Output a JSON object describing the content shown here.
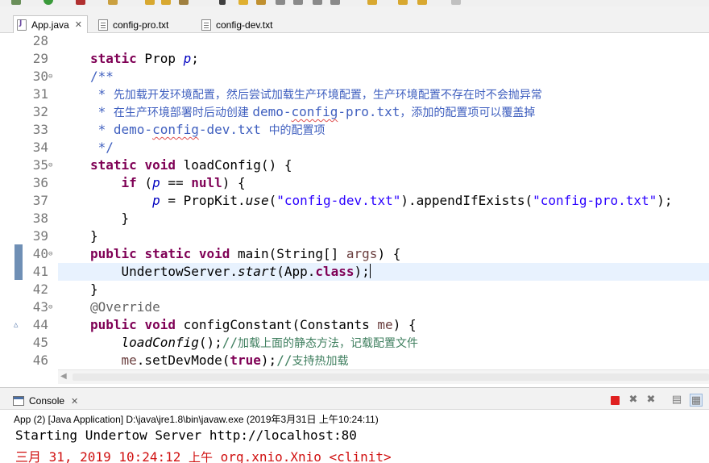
{
  "editor_tabs": [
    {
      "label": "App.java",
      "active": true,
      "icon": "java-file-icon",
      "closable": true
    },
    {
      "label": "config-pro.txt",
      "active": false,
      "icon": "text-file-icon"
    },
    {
      "label": "config-dev.txt",
      "active": false,
      "icon": "text-file-icon"
    }
  ],
  "code_lines": [
    {
      "num": "28",
      "parts": []
    },
    {
      "num": "29",
      "parts": [
        [
          "kw",
          "static"
        ],
        [
          "id",
          " Prop "
        ],
        [
          "field",
          "p"
        ],
        [
          "id",
          ";"
        ]
      ]
    },
    {
      "num": "30",
      "fold": "collapse",
      "parts": [
        [
          "cm",
          "/**"
        ]
      ]
    },
    {
      "num": "31",
      "parts": [
        [
          "cm",
          " * "
        ],
        [
          "cm-cn",
          "先加载开发环境配置，然后尝试加载生产环境配置，生产环境配置不存在时不会抛异常"
        ]
      ]
    },
    {
      "num": "32",
      "parts": [
        [
          "cm",
          " * "
        ],
        [
          "cm-cn",
          "在生产环境部署时后动创建 "
        ],
        [
          "cm",
          "demo-"
        ],
        [
          "cm squig",
          "config"
        ],
        [
          "cm",
          "-pro.txt"
        ],
        [
          "cm-cn",
          "，添加的配置项可以覆盖掉"
        ]
      ]
    },
    {
      "num": "33",
      "parts": [
        [
          "cm",
          " * demo-"
        ],
        [
          "cm squig",
          "config"
        ],
        [
          "cm",
          "-dev.txt "
        ],
        [
          "cm-cn",
          "中的配置项"
        ]
      ]
    },
    {
      "num": "34",
      "parts": [
        [
          "cm",
          " */"
        ]
      ]
    },
    {
      "num": "35",
      "fold": "collapse",
      "parts": [
        [
          "kw",
          "static"
        ],
        [
          "id",
          " "
        ],
        [
          "kw",
          "void"
        ],
        [
          "id",
          " loadConfig() {"
        ]
      ]
    },
    {
      "num": "36",
      "parts": [
        [
          "id",
          "    "
        ],
        [
          "kw",
          "if"
        ],
        [
          "id",
          " ("
        ],
        [
          "field",
          "p"
        ],
        [
          "id",
          " == "
        ],
        [
          "kw",
          "null"
        ],
        [
          "id",
          ") {"
        ]
      ]
    },
    {
      "num": "37",
      "parts": [
        [
          "id",
          "        "
        ],
        [
          "field",
          "p"
        ],
        [
          "id",
          " = PropKit."
        ],
        [
          "meth-i",
          "use"
        ],
        [
          "id",
          "("
        ],
        [
          "str",
          "\"config-dev.txt\""
        ],
        [
          "id",
          ").appendIfExists("
        ],
        [
          "str",
          "\"config-pro.txt\""
        ],
        [
          "id",
          ");"
        ]
      ]
    },
    {
      "num": "38",
      "parts": [
        [
          "id",
          "    }"
        ]
      ]
    },
    {
      "num": "39",
      "parts": [
        [
          "id",
          "}"
        ]
      ]
    },
    {
      "num": "40",
      "fold": "collapse",
      "changed": true,
      "parts": [
        [
          "kw",
          "public"
        ],
        [
          "id",
          " "
        ],
        [
          "kw",
          "static"
        ],
        [
          "id",
          " "
        ],
        [
          "kw",
          "void"
        ],
        [
          "id",
          " main(String[] "
        ],
        [
          "param",
          "args"
        ],
        [
          "id",
          ") {"
        ]
      ]
    },
    {
      "num": "41",
      "current": true,
      "changed": true,
      "parts": [
        [
          "id",
          "    UndertowServer."
        ],
        [
          "meth-i",
          "start"
        ],
        [
          "id",
          "(App."
        ],
        [
          "kw",
          "class"
        ],
        [
          "id",
          ");"
        ],
        [
          "caret",
          ""
        ]
      ]
    },
    {
      "num": "42",
      "parts": [
        [
          "id",
          "}"
        ]
      ]
    },
    {
      "num": "43",
      "fold": "collapse",
      "parts": [
        [
          "ann",
          "@Override"
        ]
      ]
    },
    {
      "num": "44",
      "override": true,
      "parts": [
        [
          "kw",
          "public"
        ],
        [
          "id",
          " "
        ],
        [
          "kw",
          "void"
        ],
        [
          "id",
          " configConstant(Constants "
        ],
        [
          "param",
          "me"
        ],
        [
          "id",
          ") {"
        ]
      ]
    },
    {
      "num": "45",
      "parts": [
        [
          "id",
          "    "
        ],
        [
          "meth-i",
          "loadConfig"
        ],
        [
          "id",
          "();"
        ],
        [
          "lc",
          "//"
        ],
        [
          "lc-cn",
          "加载上面的静态方法，记载配置文件"
        ]
      ]
    },
    {
      "num": "46",
      "parts": [
        [
          "id",
          "    "
        ],
        [
          "param",
          "me"
        ],
        [
          "id",
          ".setDevMode("
        ],
        [
          "kw",
          "true"
        ],
        [
          "id",
          ");"
        ],
        [
          "lc",
          "//"
        ],
        [
          "lc-cn",
          "支持热加载"
        ]
      ]
    }
  ],
  "console": {
    "tab_label": "Console",
    "process_description": "App (2) [Java Application] D:\\java\\jre1.8\\bin\\javaw.exe (2019年3月31日 上午10:24:11)",
    "output": [
      {
        "type": "stdout",
        "text": "Starting Undertow Server http://localhost:80"
      },
      {
        "type": "stderr",
        "prefix": "三月 31, 2019 10:24:12 ",
        "cn": "上午",
        "suffix": " org.xnio.Xnio <clinit>"
      }
    ],
    "controls": [
      {
        "name": "terminate-button",
        "icon": "stop-icon"
      },
      {
        "name": "remove-launch-button",
        "icon": "remove-icon"
      },
      {
        "name": "remove-all-launches-button",
        "icon": "remove-all-icon"
      },
      {
        "name": "clear-console-button",
        "icon": "clear-console-icon"
      },
      {
        "name": "scroll-lock-button",
        "icon": "scroll-lock-icon"
      }
    ]
  },
  "colors": {
    "keyword": "#7f0055",
    "string": "#2a00ff",
    "javadoc": "#3f5fbf",
    "line_comment": "#3f7f5f",
    "field": "#0000c0",
    "current_line": "#e8f2fe",
    "stderr": "#d01010"
  }
}
